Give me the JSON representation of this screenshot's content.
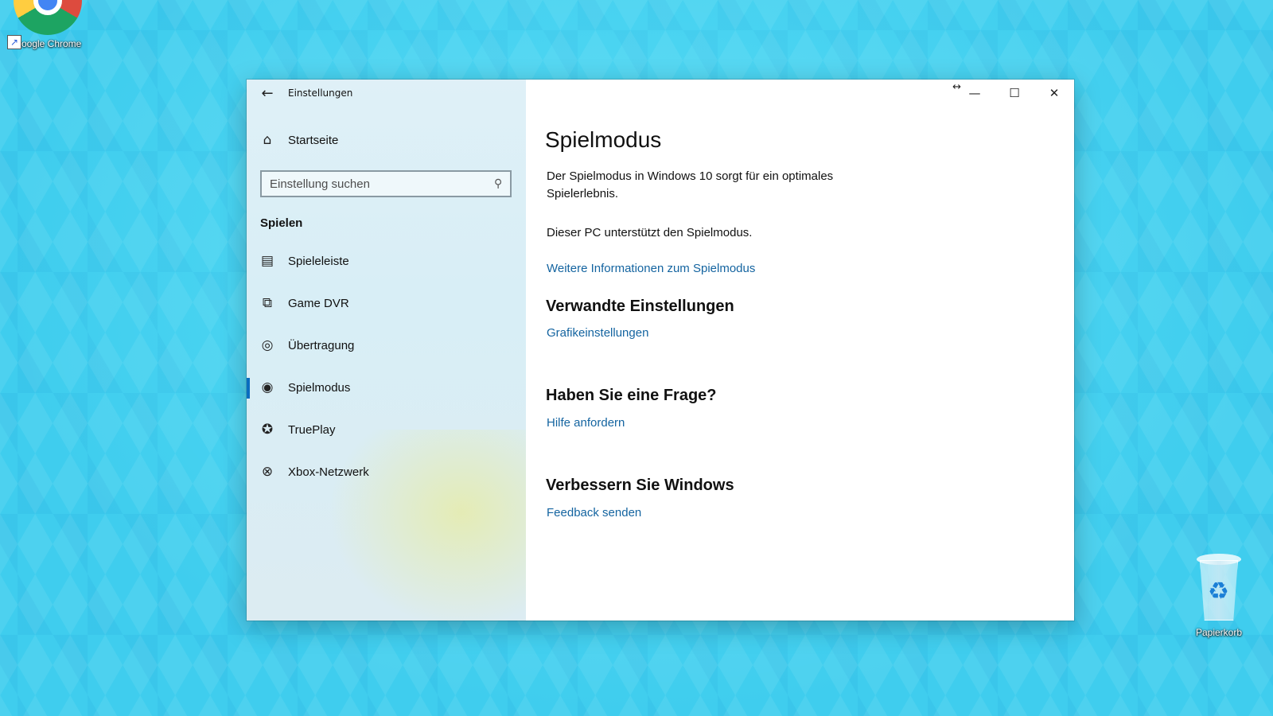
{
  "desktop": {
    "icons": {
      "chrome": "Google Chrome",
      "recycle_bin": "Papierkorb"
    }
  },
  "window": {
    "app_title": "Einstellungen",
    "controls": {
      "minimize": "—",
      "maximize": "☐",
      "close": "✕",
      "resize": "↔"
    }
  },
  "sidebar": {
    "home_label": "Startseite",
    "search_placeholder": "Einstellung suchen",
    "section_title": "Spielen",
    "items": [
      {
        "label": "Spieleleiste",
        "icon": "game-bar-icon"
      },
      {
        "label": "Game DVR",
        "icon": "game-dvr-icon"
      },
      {
        "label": "Übertragung",
        "icon": "broadcast-icon"
      },
      {
        "label": "Spielmodus",
        "icon": "game-mode-icon",
        "active": true
      },
      {
        "label": "TruePlay",
        "icon": "trueplay-icon"
      },
      {
        "label": "Xbox-Netzwerk",
        "icon": "xbox-icon"
      }
    ]
  },
  "main": {
    "title": "Spielmodus",
    "description": "Der Spielmodus in Windows 10 sorgt für ein optimales Spielerlebnis.",
    "status": "Dieser PC unterstützt den Spielmodus.",
    "more_info_link": "Weitere Informationen zum Spielmodus",
    "related": {
      "heading": "Verwandte Einstellungen",
      "link": "Grafikeinstellungen"
    },
    "question": {
      "heading": "Haben Sie eine Frage?",
      "link": "Hilfe anfordern"
    },
    "improve": {
      "heading": "Verbessern Sie Windows",
      "link": "Feedback senden"
    }
  },
  "colors": {
    "accent": "#0a6cbf",
    "link": "#1464a0"
  }
}
